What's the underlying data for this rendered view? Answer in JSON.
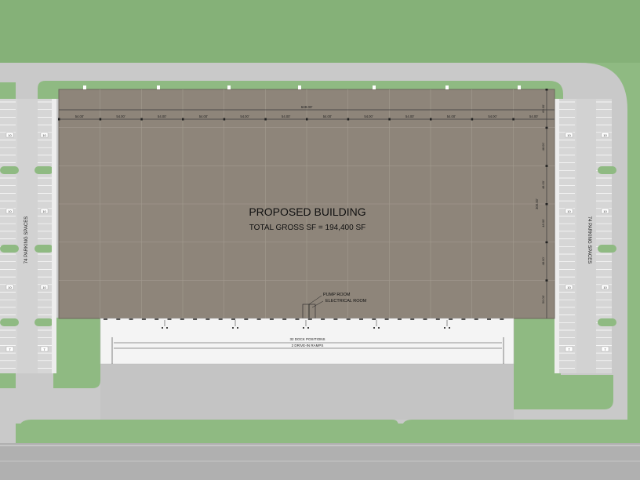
{
  "colors": {
    "grass": "#8fba82",
    "grass_dark": "#85b178",
    "pavement": "#c9c9c9",
    "pavement_light": "#d6d6d6",
    "road": "#b3b3b3",
    "building": "#8e857a",
    "grid_line": "#a39b90",
    "dock_apron": "#f4f4f4",
    "sidewalk": "#e8e8e8",
    "curb": "#ffffff"
  },
  "building": {
    "title": "PROPOSED BUILDING",
    "gross_sf": "TOTAL GROSS SF = 194,400 SF",
    "overall_width": "648.00'",
    "bay_widths": [
      "54.00'",
      "54.00'",
      "54.00'",
      "54.00'",
      "54.00'",
      "54.00'",
      "54.00'",
      "54.00'",
      "54.00'",
      "54.00'",
      "54.00'",
      "54.00'"
    ],
    "overall_depth": "300.00'",
    "bay_depths": [
      "60.00'",
      "48.00'",
      "48.00'",
      "48.00'",
      "48.00'",
      "50.00'"
    ]
  },
  "rooms": {
    "pump_room": "PUMP ROOM",
    "electrical_room": "ELECTRICAL ROOM"
  },
  "dock": {
    "positions": "32 DOCK POSITIONS",
    "ramps": "2 DRIVE-IN RAMPS"
  },
  "parking": {
    "west_label": "74 PARKING SPACES",
    "east_label": "74 PARKING SPACES",
    "row_counts": [
      "10",
      "10",
      "10",
      "7"
    ]
  }
}
